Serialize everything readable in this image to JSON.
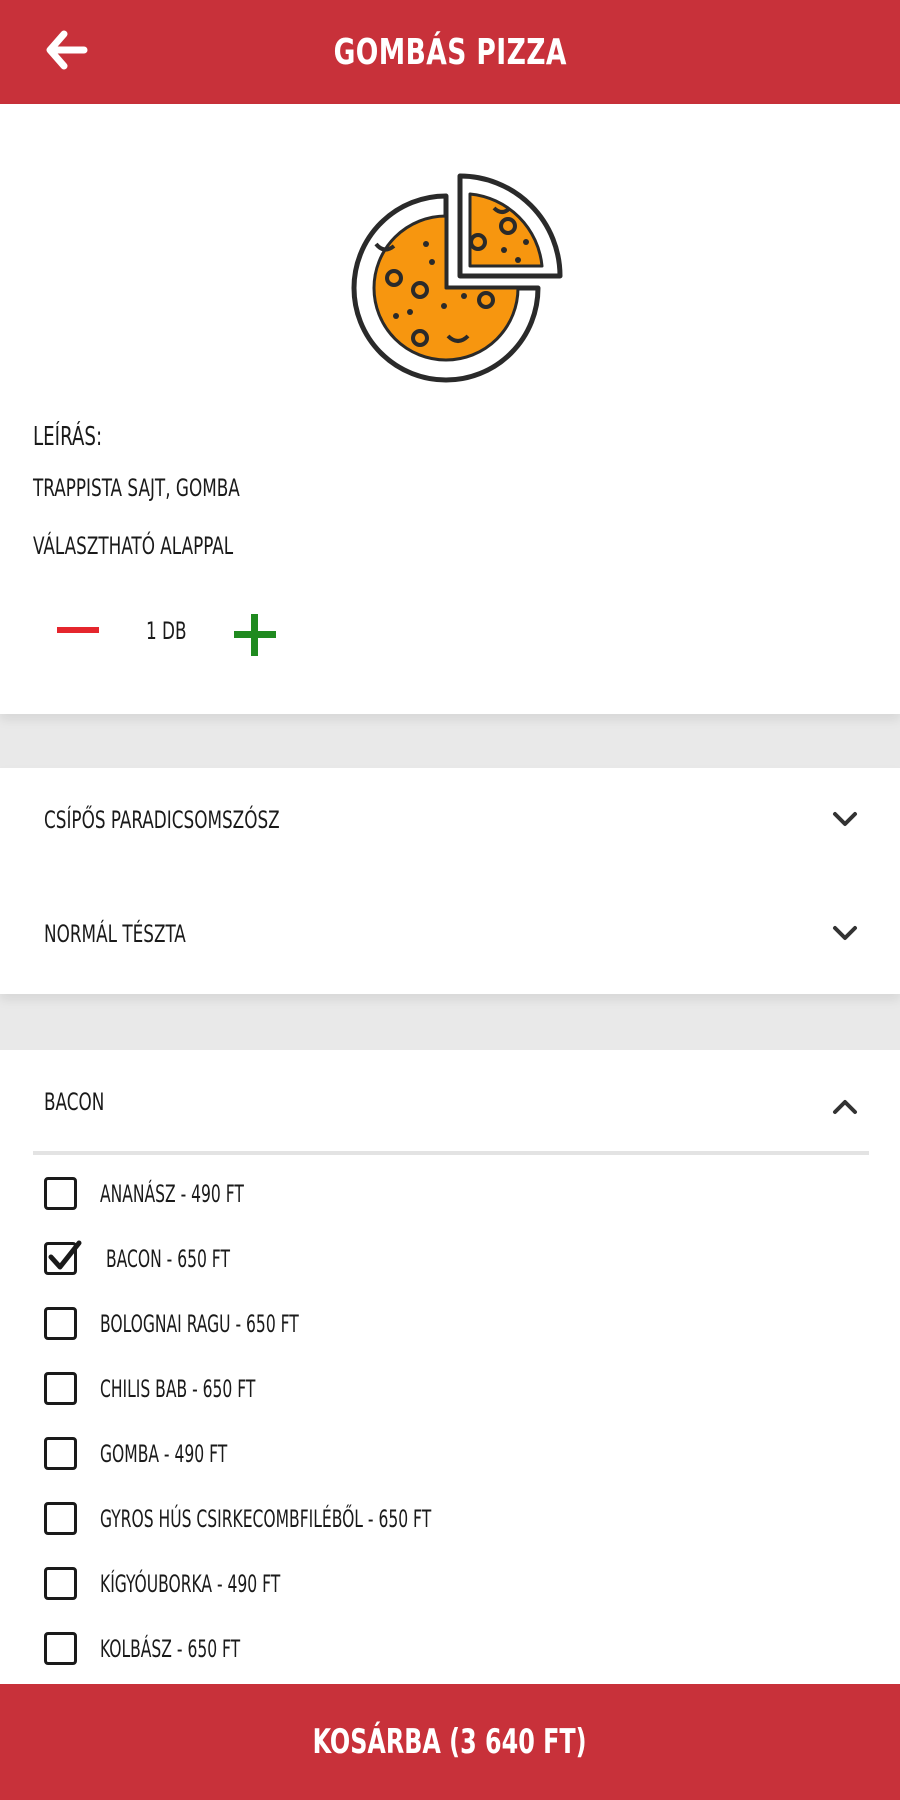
{
  "header": {
    "title": "GOMBÁS PIZZA",
    "back_icon": "arrow-left-icon",
    "color": "#c8313a"
  },
  "product": {
    "image_icon": "pizza-icon",
    "description_label": "LEÍRÁS:",
    "description": "TRAPPISTA SAJT, GOMBA",
    "base_note": "VÁLASZTHATÓ ALAPPAL",
    "quantity": "1 DB",
    "minus_icon": "minus-icon",
    "plus_icon": "plus-icon"
  },
  "options": [
    {
      "label": "CSÍPŐS PARADICSOMSZÓSZ",
      "icon": "chevron-down-icon"
    },
    {
      "label": "NORMÁL TÉSZTA",
      "icon": "chevron-down-icon"
    }
  ],
  "extras": {
    "selected_label": "BACON",
    "icon": "chevron-up-icon",
    "items": [
      {
        "label": "ANANÁSZ - 490 FT",
        "checked": false
      },
      {
        "label": "BACON - 650 FT",
        "checked": true
      },
      {
        "label": "BOLOGNAI RAGU - 650 FT",
        "checked": false
      },
      {
        "label": "CHILIS BAB - 650 FT",
        "checked": false
      },
      {
        "label": "GOMBA - 490 FT",
        "checked": false
      },
      {
        "label": "GYROS HÚS CSIRKECOMBFILÉBŐL - 650 FT",
        "checked": false
      },
      {
        "label": "KÍGYÓUBORKA - 490 FT",
        "checked": false
      },
      {
        "label": "KOLBÁSZ - 650 FT",
        "checked": false
      }
    ]
  },
  "footer": {
    "cart_label": "KOSÁRBA (3 640 FT)"
  },
  "colors": {
    "brand_red": "#c8313a",
    "minus_red": "#e5262d",
    "plus_green": "#1f8a1f",
    "pizza_orange": "#f7960f"
  }
}
